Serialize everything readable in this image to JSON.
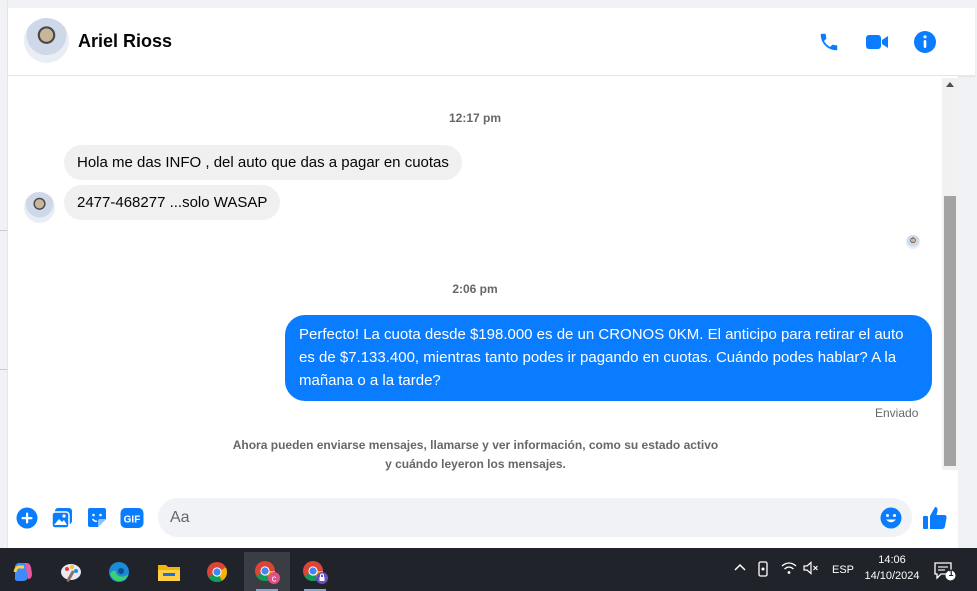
{
  "contact": {
    "name": "Ariel Rioss"
  },
  "header_icons": [
    "phone-icon",
    "video-camera-icon",
    "info-icon"
  ],
  "conversation": {
    "timestamp_1": "12:17 pm",
    "incoming_1": "Hola me das INFO , del auto que das a pagar en cuotas",
    "incoming_2": "2477-468277  ...solo WASAP",
    "timestamp_2": "2:06 pm",
    "outgoing_1": "Perfecto! La cuota desde $198.000 es de un CRONOS 0KM. El anticipo para retirar el auto es de $7.133.400, mientras tanto podes ir pagando en cuotas. Cuándo podes hablar? A la mañana o a la tarde?",
    "outgoing_status": "Enviado",
    "system_message": "Ahora pueden enviarse mensajes, llamarse y ver información, como su estado activo y cuándo leyeron los mensajes."
  },
  "composer": {
    "placeholder": "Aa",
    "gif_label": "GIF",
    "icons": [
      "plus-icon",
      "photo-icon",
      "sticker-icon",
      "gif-icon",
      "emoji-icon",
      "thumbs-up-icon"
    ]
  },
  "taskbar": {
    "apps": [
      "copilot-icon",
      "paint-icon",
      "edge-icon",
      "file-explorer-icon",
      "chrome-icon",
      "chrome-profile-c-icon",
      "chrome-profile-locked-icon"
    ],
    "language": "ESP",
    "time": "14:06",
    "date": "14/10/2024",
    "notification_count": "1"
  },
  "colors": {
    "messenger_blue": "#0a7cff",
    "incoming_bubble": "#f0f0f0",
    "taskbar": "#20232a"
  }
}
